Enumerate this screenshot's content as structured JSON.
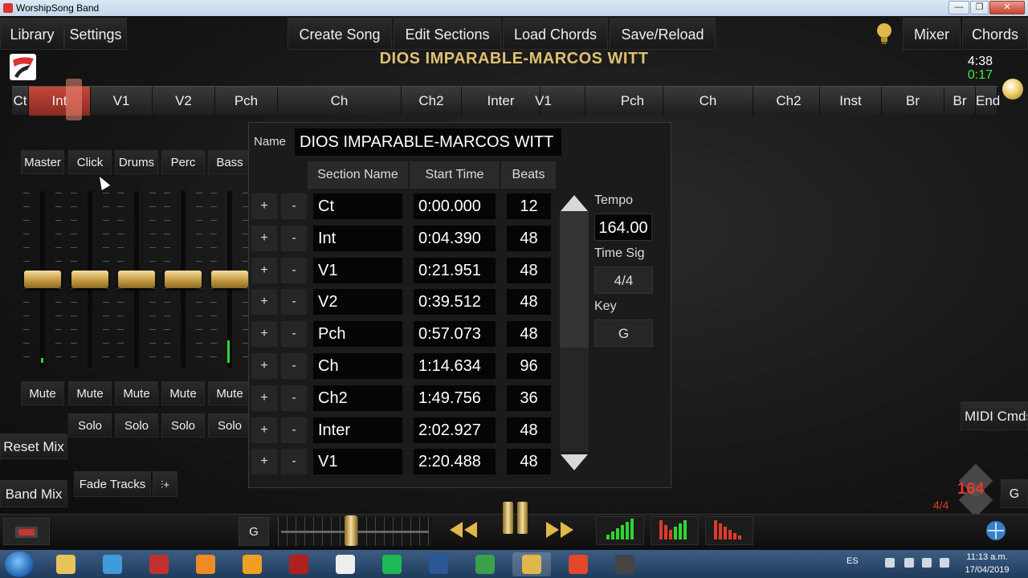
{
  "window": {
    "title": "WorshipSong Band",
    "minimize": "—",
    "maximize": "❐",
    "close": "✕"
  },
  "menu": {
    "library": "Library",
    "settings": "Settings",
    "create_song": "Create Song",
    "edit_sections": "Edit Sections",
    "load_chords": "Load Chords",
    "save_reload": "Save/Reload",
    "mixer": "Mixer",
    "chords": "Chords"
  },
  "song": {
    "title": "DIOS IMPARABLE-MARCOS WITT",
    "total_time": "4:38",
    "elapsed_time": "0:17"
  },
  "timeline": [
    "Ct",
    "Int",
    "V1",
    "V2",
    "Pch",
    "Ch",
    "Ch2",
    "Inter",
    "V1",
    "Pch",
    "Ch",
    "Ch2",
    "Inst",
    "Br",
    "Br",
    "End"
  ],
  "timeline_active_index": 1,
  "mixer": {
    "channels": [
      "Master",
      "Click",
      "Drums",
      "Perc",
      "Bass"
    ],
    "mute_label": "Mute",
    "solo_label": "Solo",
    "reset_mix": "Reset Mix",
    "band_mix": "Band Mix",
    "fade_tracks": "Fade Tracks"
  },
  "editor": {
    "name_label": "Name",
    "name_value": "DIOS IMPARABLE-MARCOS WITT",
    "headers": {
      "section_name": "Section Name",
      "start_time": "Start Time",
      "beats": "Beats"
    },
    "add_label": "+",
    "remove_label": "-",
    "rows": [
      {
        "name": "Ct",
        "start": "0:00.000",
        "beats": "12"
      },
      {
        "name": "Int",
        "start": "0:04.390",
        "beats": "48"
      },
      {
        "name": "V1",
        "start": "0:21.951",
        "beats": "48"
      },
      {
        "name": "V2",
        "start": "0:39.512",
        "beats": "48"
      },
      {
        "name": "Pch",
        "start": "0:57.073",
        "beats": "48"
      },
      {
        "name": "Ch",
        "start": "1:14.634",
        "beats": "96"
      },
      {
        "name": "Ch2",
        "start": "1:49.756",
        "beats": "36"
      },
      {
        "name": "Inter",
        "start": "2:02.927",
        "beats": "48"
      },
      {
        "name": "V1",
        "start": "2:20.488",
        "beats": "48"
      }
    ],
    "tempo_label": "Tempo",
    "tempo_value": "164.00",
    "time_sig_label": "Time Sig",
    "time_sig_value": "4/4",
    "key_label": "Key",
    "key_value": "G"
  },
  "right_panel": {
    "midi_button": "MIDI Cmds",
    "tempo_badge": "164",
    "time_sig_badge": "4/4",
    "key": "G"
  },
  "transport": {
    "key": "G",
    "position_fraction": 0.47
  },
  "taskbar": {
    "language": "ES",
    "time": "11:13 a.m.",
    "date": "17/04/2019"
  },
  "colors": {
    "accent_gold": "#e0b84a",
    "active_section": "#c4473b",
    "elapsed_green": "#3ee83e",
    "tempo_red": "#e03a2a"
  }
}
